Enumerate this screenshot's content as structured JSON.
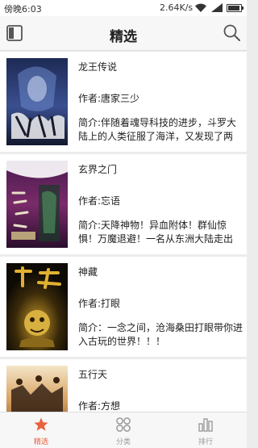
{
  "status_bar": {
    "time": "傍晚6:03",
    "network_speed": "2.64K/s",
    "battery_level": 0.9
  },
  "header": {
    "title": "精选"
  },
  "books": [
    {
      "title": "龙王传说",
      "author": "作者:唐家三少",
      "intro": "简介:伴随着魂导科技的进步，斗罗大陆上的人类征服了海洋，又发现了两片..."
    },
    {
      "title": "玄界之门",
      "author": "作者:忘语",
      "intro": "简介:天降神物！异血附体！群仙惊惧！万魔退避！一名从东洲大陆走出的..."
    },
    {
      "title": "神藏",
      "author": "作者:打眼",
      "intro": "简介：一念之间，沧海桑田打眼带你进入古玩的世界！！！"
    },
    {
      "title": "五行天",
      "author": "作者:方想",
      "intro": ""
    }
  ],
  "tabs": [
    {
      "label": "精选",
      "icon": "star-icon",
      "active": true
    },
    {
      "label": "分类",
      "icon": "grid-icon",
      "active": false
    },
    {
      "label": "排行",
      "icon": "bar-chart-icon",
      "active": false
    }
  ],
  "colors": {
    "accent": "#e8623f",
    "inactive": "#9a9a9a"
  }
}
